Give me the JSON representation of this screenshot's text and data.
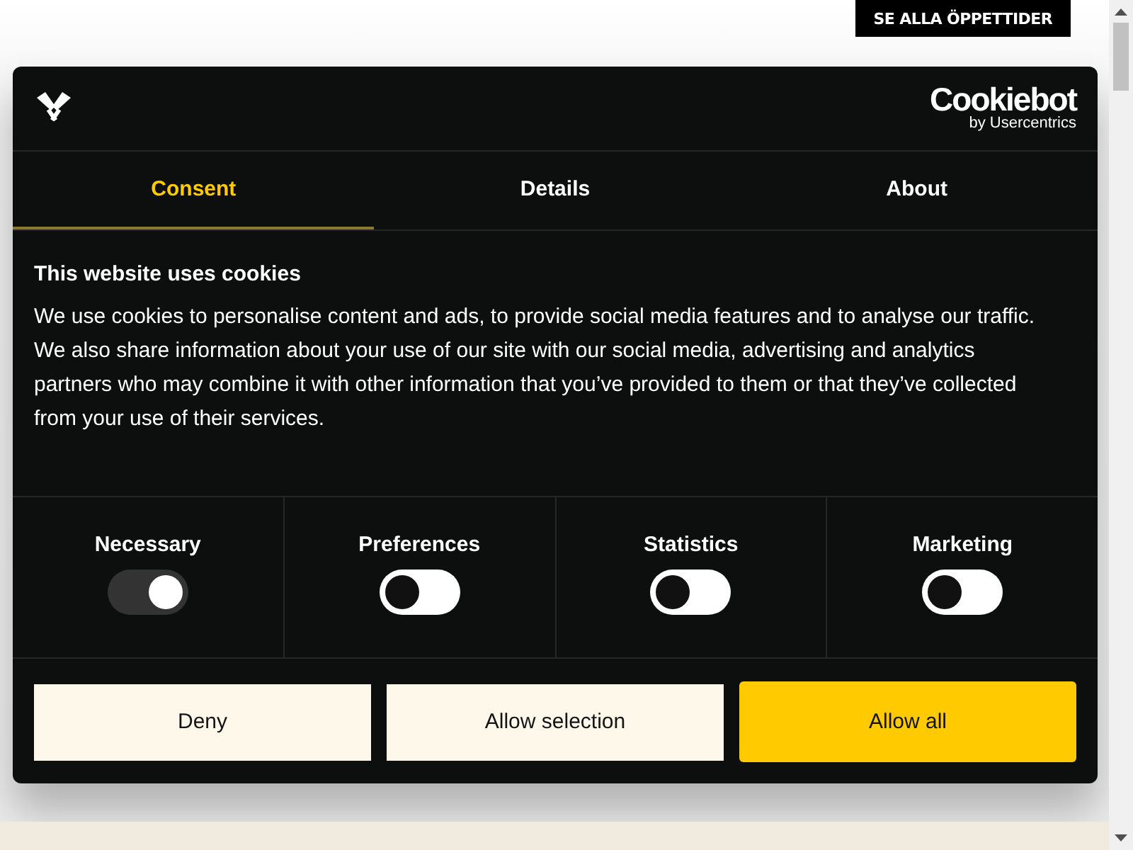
{
  "header_button": "SE ALLA ÖPPETTIDER",
  "dialog": {
    "brand": {
      "name": "Cookiebot",
      "byline": "by Usercentrics"
    },
    "tabs": [
      {
        "label": "Consent",
        "selected": true
      },
      {
        "label": "Details",
        "selected": false
      },
      {
        "label": "About",
        "selected": false
      }
    ],
    "heading": "This website uses cookies",
    "body": "We use cookies to personalise content and ads, to provide social media features and to analyse our traffic. We also share information about your use of our site with our social media, advertising and analytics partners who may combine it with other information that you’ve provided to them or that they’ve collected from your use of their services.",
    "categories": [
      {
        "label": "Necessary",
        "on": true,
        "disabled": true
      },
      {
        "label": "Preferences",
        "on": false,
        "disabled": false
      },
      {
        "label": "Statistics",
        "on": false,
        "disabled": false
      },
      {
        "label": "Marketing",
        "on": false,
        "disabled": false
      }
    ],
    "buttons": [
      {
        "label": "Deny",
        "kind": "secondary"
      },
      {
        "label": "Allow selection",
        "kind": "secondary"
      },
      {
        "label": "Allow all",
        "kind": "primary"
      }
    ]
  }
}
